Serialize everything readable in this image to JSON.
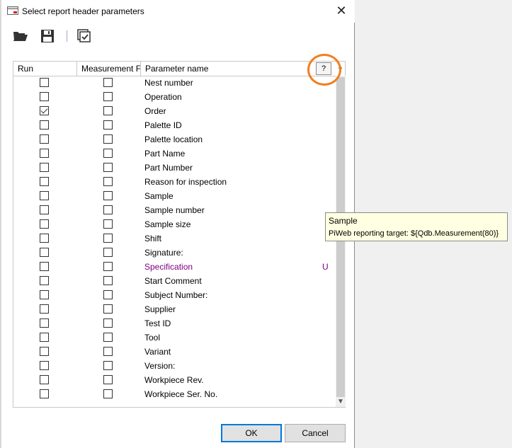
{
  "window": {
    "title": "Select report header parameters",
    "close_glyph": "✕"
  },
  "toolbar": {
    "open_icon": "folder-open-icon",
    "save_icon": "save-icon",
    "select_icon": "checkbox-select-icon"
  },
  "grid": {
    "columns": [
      "Run",
      "Measurement F",
      "Parameter name"
    ],
    "help_button_label": "?",
    "rows": [
      {
        "name": "Nest number",
        "run": false,
        "measurement": false,
        "special": false,
        "flag": ""
      },
      {
        "name": "Operation",
        "run": false,
        "measurement": false,
        "special": false,
        "flag": ""
      },
      {
        "name": "Order",
        "run": true,
        "measurement": false,
        "special": false,
        "flag": ""
      },
      {
        "name": "Palette ID",
        "run": false,
        "measurement": false,
        "special": false,
        "flag": ""
      },
      {
        "name": "Palette location",
        "run": false,
        "measurement": false,
        "special": false,
        "flag": ""
      },
      {
        "name": "Part Name",
        "run": false,
        "measurement": false,
        "special": false,
        "flag": ""
      },
      {
        "name": "Part Number",
        "run": false,
        "measurement": false,
        "special": false,
        "flag": ""
      },
      {
        "name": "Reason for inspection",
        "run": false,
        "measurement": false,
        "special": false,
        "flag": ""
      },
      {
        "name": "Sample",
        "run": false,
        "measurement": false,
        "special": false,
        "flag": ""
      },
      {
        "name": "Sample number",
        "run": false,
        "measurement": false,
        "special": false,
        "flag": ""
      },
      {
        "name": "Sample size",
        "run": false,
        "measurement": false,
        "special": false,
        "flag": ""
      },
      {
        "name": "Shift",
        "run": false,
        "measurement": false,
        "special": false,
        "flag": ""
      },
      {
        "name": "Signature:",
        "run": false,
        "measurement": false,
        "special": false,
        "flag": ""
      },
      {
        "name": "Specification",
        "run": false,
        "measurement": false,
        "special": true,
        "flag": "U"
      },
      {
        "name": "Start Comment",
        "run": false,
        "measurement": false,
        "special": false,
        "flag": ""
      },
      {
        "name": "Subject Number:",
        "run": false,
        "measurement": false,
        "special": false,
        "flag": ""
      },
      {
        "name": "Supplier",
        "run": false,
        "measurement": false,
        "special": false,
        "flag": ""
      },
      {
        "name": "Test ID",
        "run": false,
        "measurement": false,
        "special": false,
        "flag": ""
      },
      {
        "name": "Tool",
        "run": false,
        "measurement": false,
        "special": false,
        "flag": ""
      },
      {
        "name": "Variant",
        "run": false,
        "measurement": false,
        "special": false,
        "flag": ""
      },
      {
        "name": "Version:",
        "run": false,
        "measurement": false,
        "special": false,
        "flag": ""
      },
      {
        "name": "Workpiece Rev.",
        "run": false,
        "measurement": false,
        "special": false,
        "flag": ""
      },
      {
        "name": "Workpiece Ser. No.",
        "run": false,
        "measurement": false,
        "special": false,
        "flag": ""
      }
    ]
  },
  "tooltip": {
    "title": "Sample",
    "body": "PiWeb reporting target: ${Qdb.Measurement(80)}"
  },
  "buttons": {
    "ok_label": "OK",
    "cancel_label": "Cancel"
  },
  "colors": {
    "special_text": "#800080",
    "annotation": "#f08020",
    "tooltip_bg": "#ffffe1"
  }
}
